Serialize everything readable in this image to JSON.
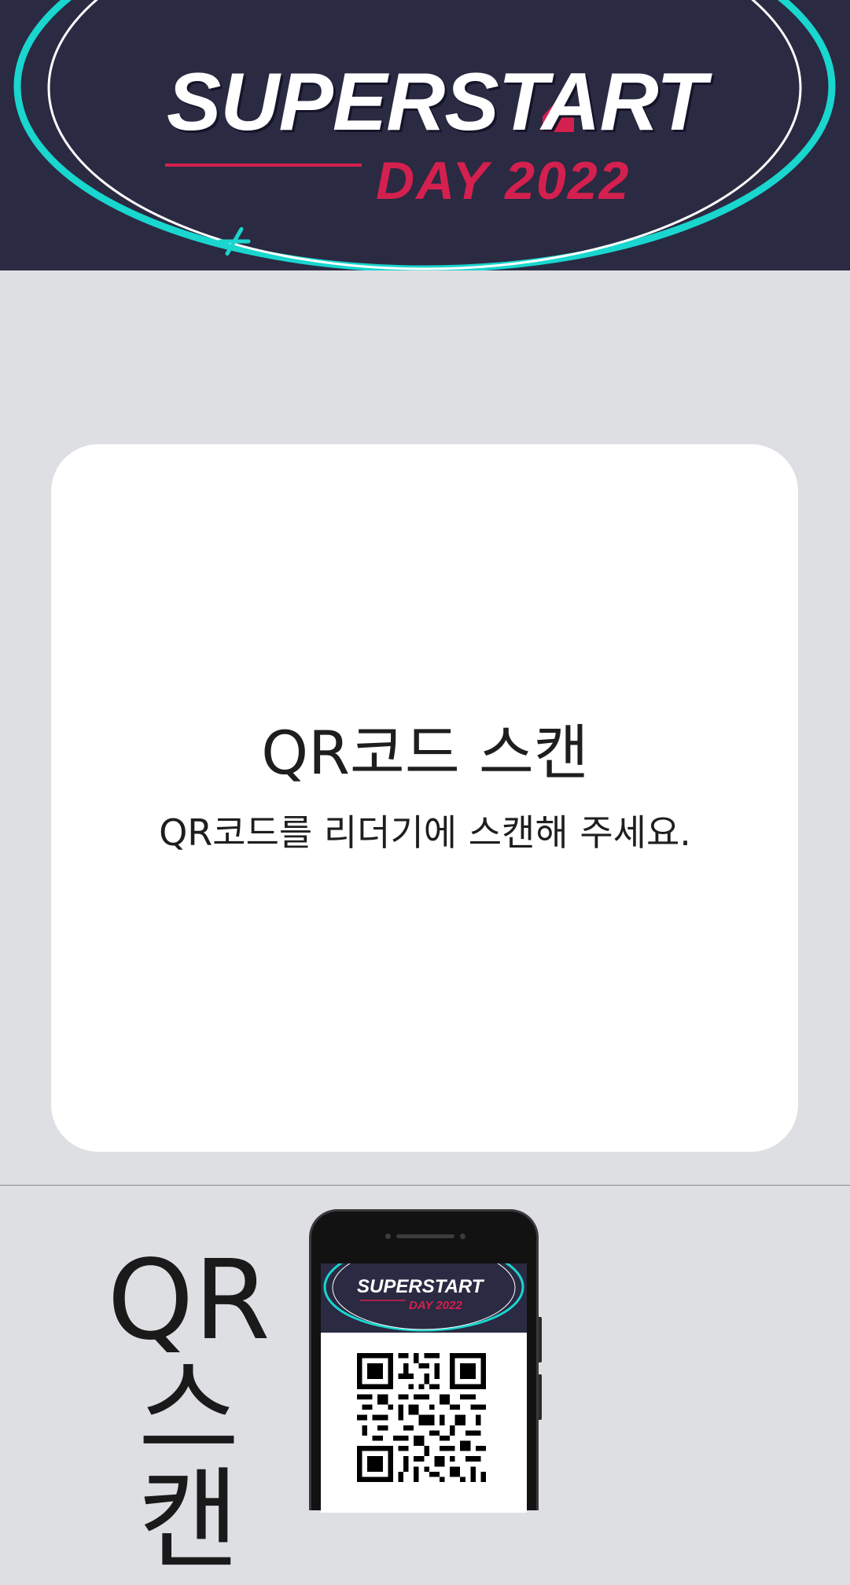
{
  "brand": {
    "title": "SUPERSTART",
    "subtitle": "DAY 2022",
    "colors": {
      "navy": "#2a2a42",
      "accent": "#d4204f",
      "cyan": "#19d6cf"
    }
  },
  "card": {
    "title": "QR코드 스캔",
    "subtitle": "QR코드를 리더기에 스캔해 주세요."
  },
  "guide": {
    "label_line1": "QR",
    "label_line2": "스캔",
    "icons": [
      "phone-icon",
      "qr-code-icon"
    ]
  }
}
